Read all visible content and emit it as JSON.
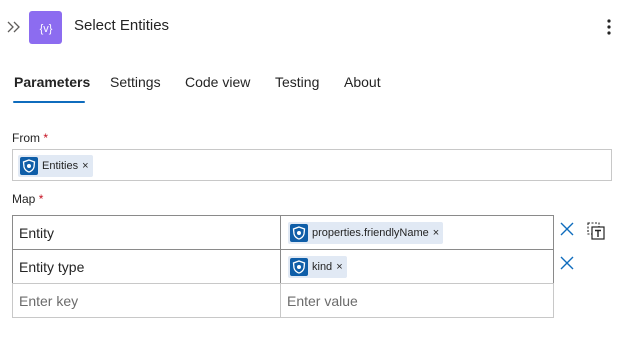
{
  "header": {
    "title": "Select Entities",
    "action_icon_glyph": "{v}",
    "action_icon_color": "#8c6cf0"
  },
  "tabs": [
    {
      "label": "Parameters",
      "active": true
    },
    {
      "label": "Settings",
      "active": false
    },
    {
      "label": "Code view",
      "active": false
    },
    {
      "label": "Testing",
      "active": false
    },
    {
      "label": "About",
      "active": false
    }
  ],
  "from": {
    "label": "From",
    "required_marker": "*",
    "token": {
      "label": "Entities",
      "remove": "×",
      "icon": "sentinel-shield-icon"
    }
  },
  "map": {
    "label": "Map",
    "required_marker": "*",
    "rows": [
      {
        "key": "Entity",
        "value_token": {
          "label": "properties.friendlyName",
          "remove": "×",
          "icon": "sentinel-shield-icon"
        }
      },
      {
        "key": "Entity type",
        "value_token": {
          "label": "kind",
          "remove": "×",
          "icon": "sentinel-shield-icon"
        }
      }
    ],
    "empty_row": {
      "key_placeholder": "Enter key",
      "value_placeholder": "Enter value"
    }
  },
  "colors": {
    "accent": "#0f6cbd",
    "token_bg": "#e1e9f4",
    "token_icon_bg": "#0f5ea8",
    "required": "#c50f1f"
  }
}
